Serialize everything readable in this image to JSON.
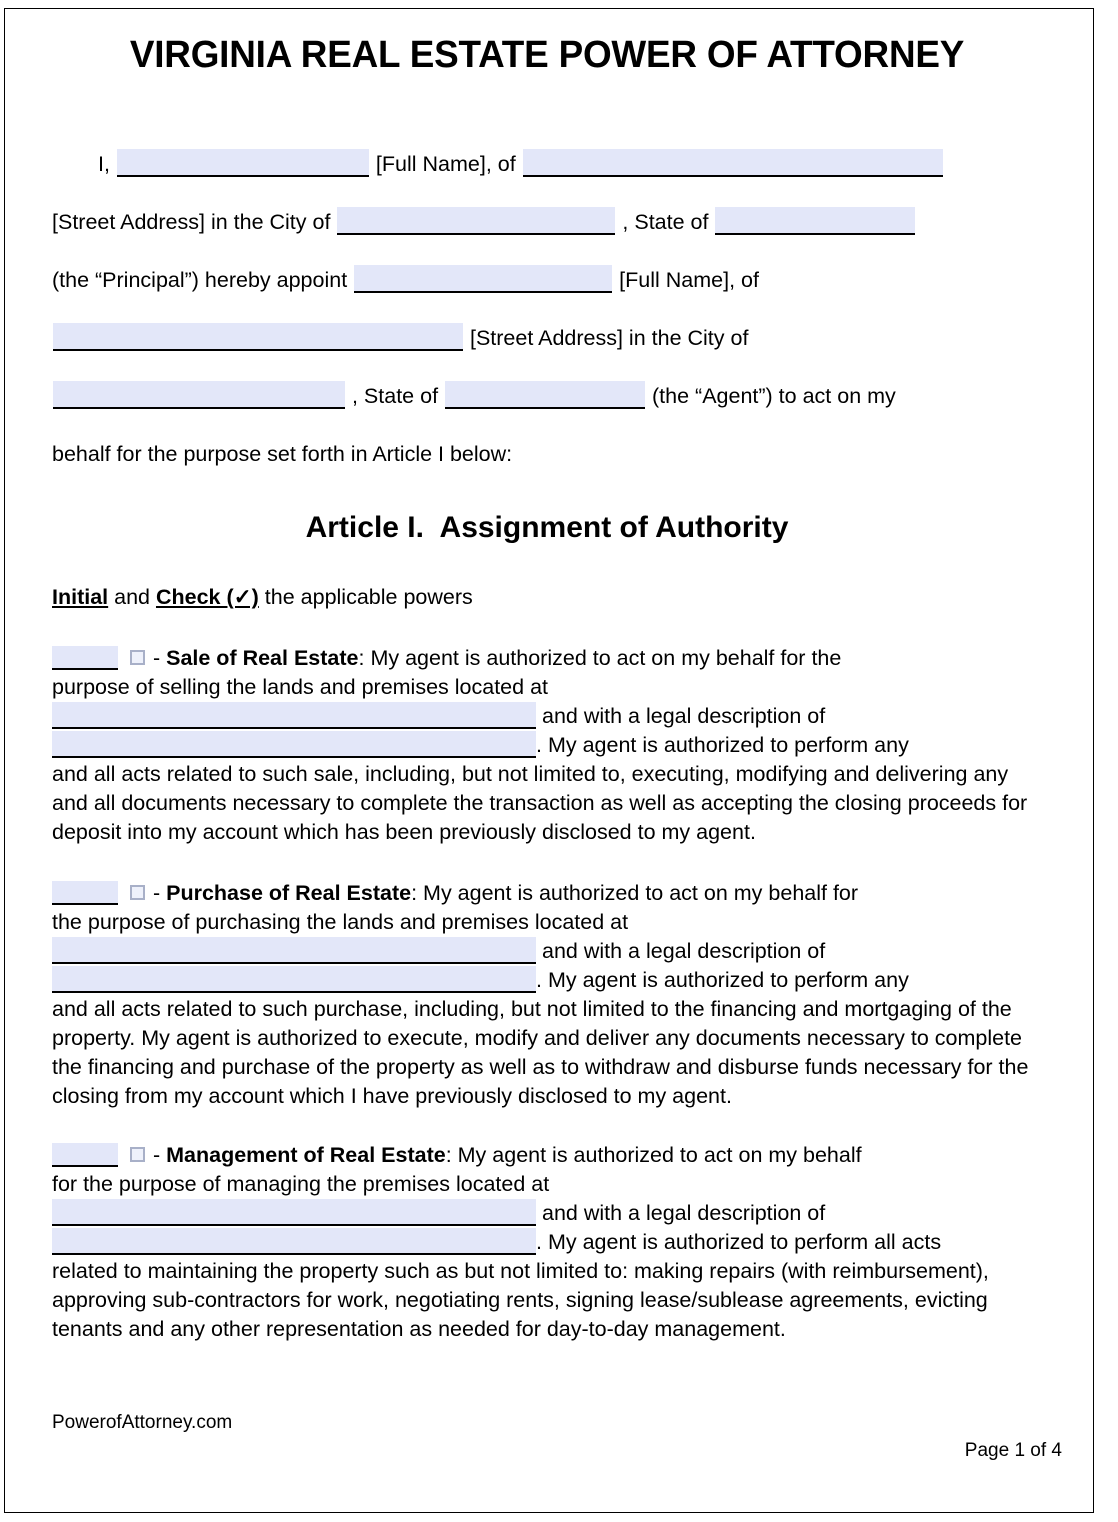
{
  "document": {
    "title": "VIRGINIA REAL ESTATE POWER OF ATTORNEY",
    "article_heading": "Article I.  Assignment of Authority",
    "instruction_pre": "",
    "instruction_initial": "Initial",
    "instruction_and": " and ",
    "instruction_check": "Check (✓)",
    "instruction_post": " the applicable powers"
  },
  "intro": {
    "line1_a": "I,",
    "line1_b": "[Full Name], of",
    "line2_a": "[Street Address] in the City of",
    "line2_b": ", State of",
    "line3_a": "(the “Principal”) hereby appoint",
    "line3_b": "[Full Name], of",
    "line4_a": "[Street Address] in the City of",
    "line5_a": ", State of",
    "line5_b": "(the “Agent”) to act on my",
    "line6": "behalf for the purpose set forth in Article I below:"
  },
  "powers": [
    {
      "id": "sale",
      "title": "Sale of Real Estate",
      "dash": " - ",
      "colon": ":",
      "lead": " My agent is authorized to act on my behalf for the",
      "line2": "purpose of selling the lands and premises located at",
      "mid1": "and with a legal description of",
      "mid2": ".  My agent is authorized to perform any",
      "body": "and all acts related to such sale, including, but not limited to, executing, modifying and delivering any and all documents necessary to complete the transaction as well as accepting the closing proceeds for deposit into my account which has been previously disclosed to my agent."
    },
    {
      "id": "purchase",
      "title": "Purchase of Real Estate",
      "dash": " - ",
      "colon": ":",
      "lead": " My agent is authorized to act on my behalf for",
      "line2": "the purpose of purchasing the lands and premises located at",
      "mid1": "and with a legal description of",
      "mid2": ".  My agent is authorized to perform any",
      "body": "and all acts related to such purchase, including, but not limited to the financing and mortgaging of the property. My agent is authorized to execute, modify and deliver any documents necessary to complete the financing and purchase of the property as well as to withdraw and disburse funds necessary for the closing from my account which I have previously disclosed to my agent."
    },
    {
      "id": "management",
      "title": "Management of Real Estate",
      "dash": " - ",
      "colon": ":",
      "lead": " My agent is authorized to act on my behalf",
      "line2": "for the purpose of managing the premises located at",
      "mid1": "and with a legal description of",
      "mid2": ". My agent is authorized to perform all acts",
      "body": "related to maintaining the property such as but not limited to: making repairs (with reimbursement), approving sub-contractors for work, negotiating rents, signing lease/sublease agreements, evicting tenants and any other representation as needed for day-to-day management."
    }
  ],
  "footer": {
    "brand": "PowerofAttorney.com",
    "page": "Page 1 of 4"
  },
  "colors": {
    "field_fill": "#e3e7f9",
    "field_rule": "#000000",
    "checkbox_border": "#a8b0c8",
    "text": "#000000",
    "page_border": "#000000"
  }
}
